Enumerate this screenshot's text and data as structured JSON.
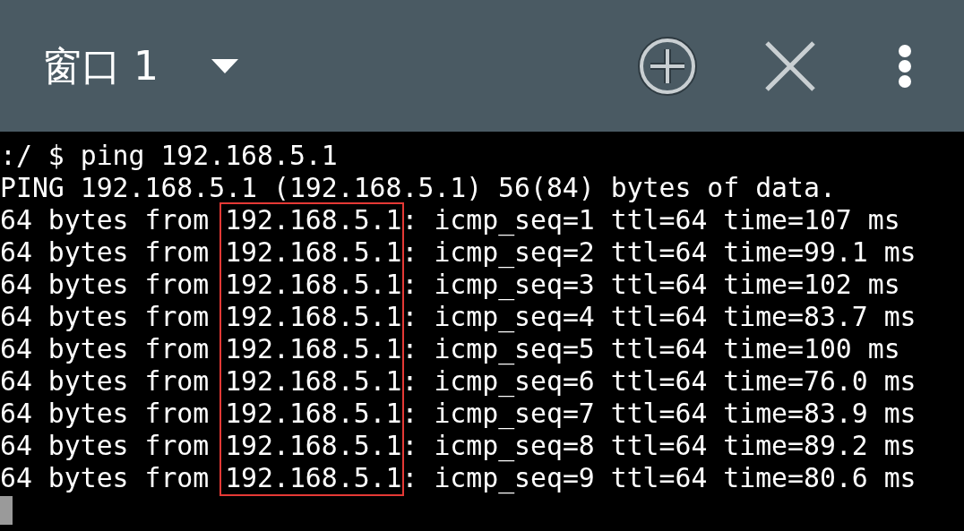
{
  "tab_bar": {
    "title": "窗口 1"
  },
  "terminal": {
    "hosts_highlighted": true,
    "lines": [
      {
        "kind": "plain",
        "text": ":/ $ ping 192.168.5.1"
      },
      {
        "kind": "plain",
        "text": "PING 192.168.5.1 (192.168.5.1) 56(84) bytes of data."
      },
      {
        "kind": "reply",
        "prefix": "64 bytes from ",
        "host": "192.168.5.1",
        "rest": ": icmp_seq=1 ttl=64 time=107 ms"
      },
      {
        "kind": "reply",
        "prefix": "64 bytes from ",
        "host": "192.168.5.1",
        "rest": ": icmp_seq=2 ttl=64 time=99.1 ms"
      },
      {
        "kind": "reply",
        "prefix": "64 bytes from ",
        "host": "192.168.5.1",
        "rest": ": icmp_seq=3 ttl=64 time=102 ms"
      },
      {
        "kind": "reply",
        "prefix": "64 bytes from ",
        "host": "192.168.5.1",
        "rest": ": icmp_seq=4 ttl=64 time=83.7 ms"
      },
      {
        "kind": "reply",
        "prefix": "64 bytes from ",
        "host": "192.168.5.1",
        "rest": ": icmp_seq=5 ttl=64 time=100 ms"
      },
      {
        "kind": "reply",
        "prefix": "64 bytes from ",
        "host": "192.168.5.1",
        "rest": ": icmp_seq=6 ttl=64 time=76.0 ms"
      },
      {
        "kind": "reply",
        "prefix": "64 bytes from ",
        "host": "192.168.5.1",
        "rest": ": icmp_seq=7 ttl=64 time=83.9 ms"
      },
      {
        "kind": "reply",
        "prefix": "64 bytes from ",
        "host": "192.168.5.1",
        "rest": ": icmp_seq=8 ttl=64 time=89.2 ms"
      },
      {
        "kind": "reply",
        "prefix": "64 bytes from ",
        "host": "192.168.5.1",
        "rest": ": icmp_seq=9 ttl=64 time=80.6 ms"
      }
    ]
  }
}
